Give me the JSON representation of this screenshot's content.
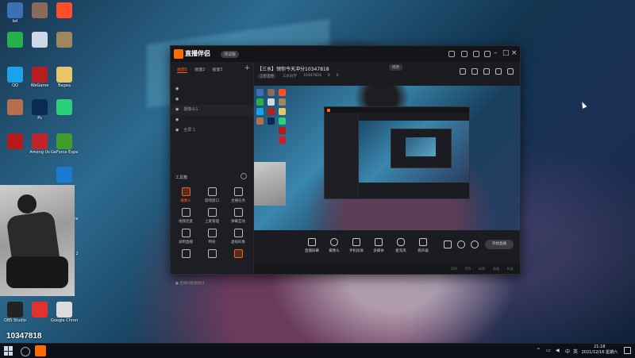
{
  "desktop": {
    "icons": [
      {
        "label": "bd",
        "color": "#3c6fb3"
      },
      {
        "label": "",
        "color": "#8a6a5a"
      },
      {
        "label": "",
        "color": "#ff4f2a"
      },
      {
        "label": "",
        "color": "#25b04a"
      },
      {
        "label": "",
        "color": "#cfd8e6"
      },
      {
        "label": "",
        "color": "#a0855e"
      },
      {
        "label": "QQ",
        "color": "#1aa3e8"
      },
      {
        "label": "WeGame",
        "color": "#b31e1e"
      },
      {
        "label": "Bagea",
        "color": "#e7c66b"
      },
      {
        "label": "",
        "color": "#b56f4e"
      },
      {
        "label": "Ps",
        "color": "#0b2a52"
      },
      {
        "label": "",
        "color": "#2ad07a"
      },
      {
        "label": "",
        "color": "#b41a1a"
      },
      {
        "label": "Among Us",
        "color": "#c3242b"
      },
      {
        "label": "GeForce Experience",
        "color": "#3f9d2b"
      },
      {
        "label": "",
        "color": "#1a7cd1"
      },
      {
        "label": "Adobe Premie...",
        "color": "#2a0a40"
      },
      {
        "label": "Borderlands 2",
        "color": "#d2a21c"
      },
      {
        "label": "OBS Studio",
        "color": "#222"
      },
      {
        "label": "",
        "color": "#e23131"
      },
      {
        "label": "Google Chrome",
        "color": "#dcdcdc"
      },
      {
        "label": "",
        "color": "#e73131"
      },
      {
        "label": "",
        "color": "#2ab14a"
      },
      {
        "label": "",
        "color": "#c7c7c7"
      },
      {
        "label": "1_20211070...",
        "color": "#e9e9e9"
      },
      {
        "label": "",
        "color": "#cfcfcf"
      },
      {
        "label": "1_2021101...",
        "color": "#e2e2e2"
      },
      {
        "label": "",
        "color": "#c23d3d"
      },
      {
        "label": "",
        "color": "#e3a22b"
      },
      {
        "label": "YY",
        "color": "#ffd23b"
      }
    ]
  },
  "watermark": {
    "room_id": "10347818"
  },
  "app": {
    "brand": "直播伴侣",
    "version": "测试版",
    "room_title": "【三水】领你今天冲分10347818",
    "room_tag": "修改",
    "meta": [
      "全部直播",
      "三水同学",
      "10347818",
      "0",
      "0"
    ],
    "tabs": [
      "画面1",
      "画面2",
      "画面3"
    ],
    "layers": [
      "",
      "",
      "摄像头1",
      "",
      "全屏 1"
    ],
    "tools_title": "工具箱",
    "tools": [
      {
        "label": "摄像头",
        "hot": true
      },
      {
        "label": "游戏窗口",
        "hot": false
      },
      {
        "label": "主播任务",
        "hot": false
      },
      {
        "label": "视频连麦",
        "hot": false
      },
      {
        "label": "上麦管理",
        "hot": false
      },
      {
        "label": "弹幕互动",
        "hot": false
      },
      {
        "label": "录制直播",
        "hot": false
      },
      {
        "label": "特效",
        "hot": false
      },
      {
        "label": "虚拟形象",
        "hot": false
      },
      {
        "label": "",
        "hot": false
      },
      {
        "label": "",
        "hot": false
      },
      {
        "label": "",
        "hot": true
      }
    ],
    "sidebar_footer": "● 直播间数据统计",
    "controls": [
      "直播屏幕",
      "摄像头",
      "手机投屏",
      "多媒体",
      "麦克风",
      "扬声器"
    ],
    "golive": "开始直播",
    "status": [
      "CPU",
      "FPS",
      "码率",
      "丢帧",
      "时长"
    ]
  },
  "taskbar": {
    "time": "21:18",
    "date": "2021/12/16 星期六",
    "tray_lang": "中",
    "tray_ime": "英"
  }
}
